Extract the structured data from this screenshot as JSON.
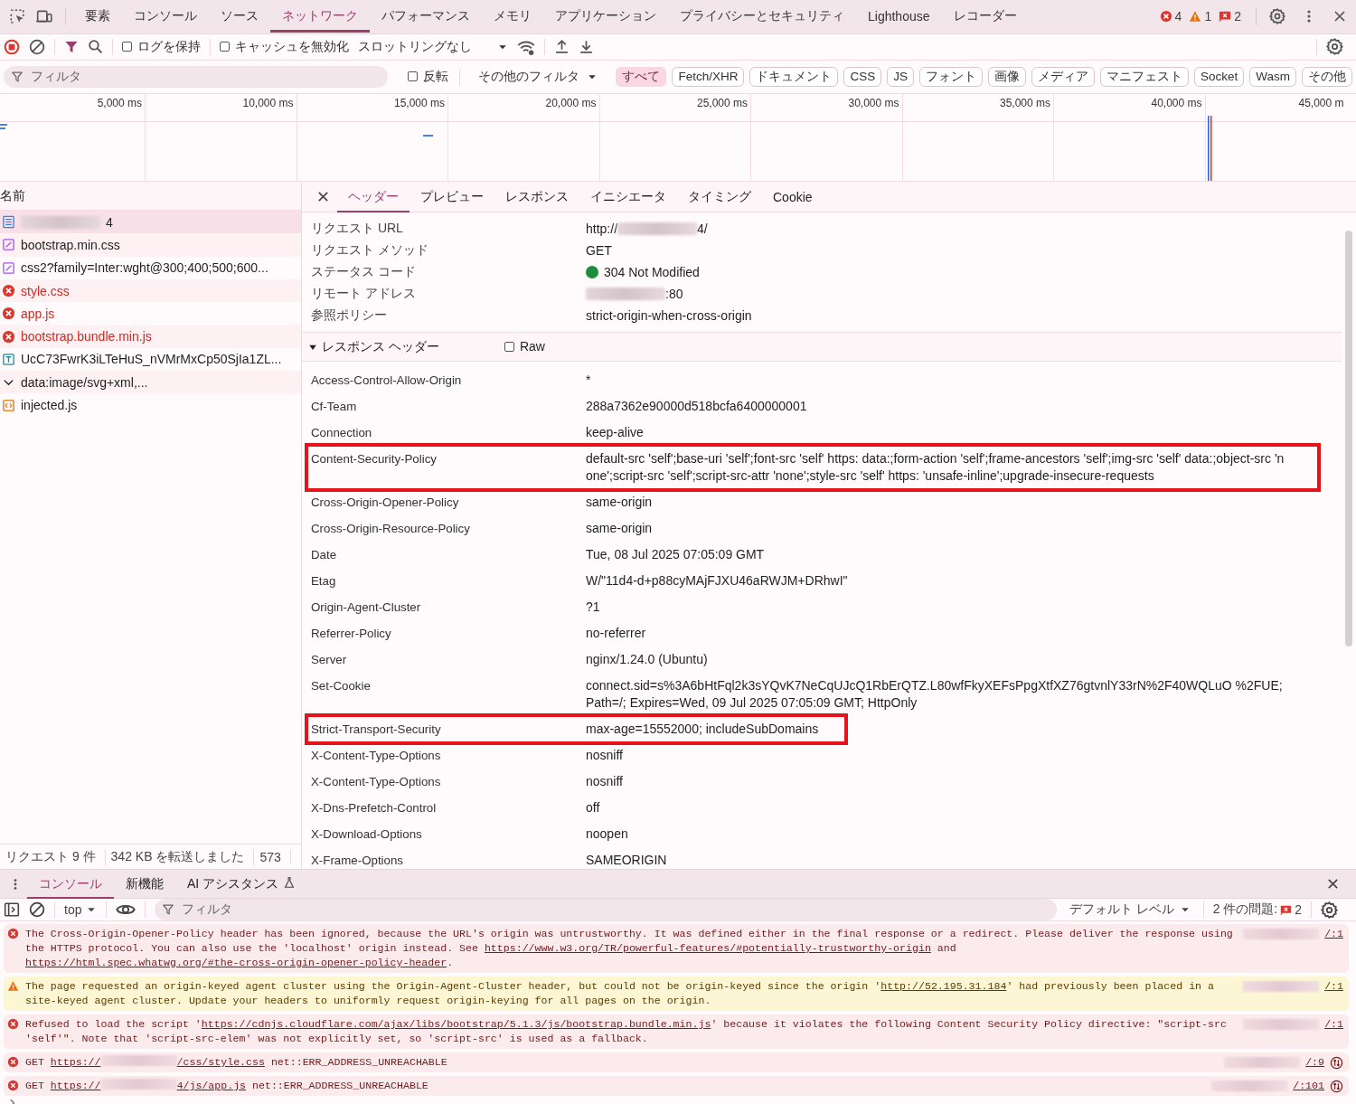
{
  "main_tabs": [
    {
      "label": "要素",
      "selected": false
    },
    {
      "label": "コンソール",
      "selected": false
    },
    {
      "label": "ソース",
      "selected": false
    },
    {
      "label": "ネットワーク",
      "selected": true
    },
    {
      "label": "パフォーマンス",
      "selected": false
    },
    {
      "label": "メモリ",
      "selected": false
    },
    {
      "label": "アプリケーション",
      "selected": false
    },
    {
      "label": "プライバシーとセキュリティ",
      "selected": false
    },
    {
      "label": "Lighthouse",
      "selected": false
    },
    {
      "label": "レコーダー",
      "selected": false
    }
  ],
  "issue_counts": {
    "errors": "4",
    "warnings": "1",
    "issues": "2"
  },
  "network_toolbar": {
    "recording": true,
    "preserve_log": {
      "label": "ログを保持",
      "checked": false
    },
    "disable_cache": {
      "label": "キャッシュを無効化",
      "checked": false
    },
    "throttling": "スロットリングなし"
  },
  "filter_bar": {
    "placeholder": "フィルタ",
    "invert": {
      "label": "反転",
      "checked": false
    },
    "more_filters": "その他のフィルタ",
    "types": [
      {
        "label": "すべて",
        "selected": true
      },
      {
        "label": "Fetch/XHR",
        "selected": false
      },
      {
        "label": "ドキュメント",
        "selected": false
      },
      {
        "label": "CSS",
        "selected": false
      },
      {
        "label": "JS",
        "selected": false
      },
      {
        "label": "フォント",
        "selected": false
      },
      {
        "label": "画像",
        "selected": false
      },
      {
        "label": "メディア",
        "selected": false
      },
      {
        "label": "マニフェスト",
        "selected": false
      },
      {
        "label": "Socket",
        "selected": false
      },
      {
        "label": "Wasm",
        "selected": false
      },
      {
        "label": "その他",
        "selected": false
      }
    ]
  },
  "timeline": {
    "ticks": [
      "5,000 ms",
      "10,000 ms",
      "15,000 ms",
      "20,000 ms",
      "25,000 ms",
      "30,000 ms",
      "35,000 ms",
      "40,000 ms",
      "45,000 m"
    ]
  },
  "requests": {
    "column": "名前",
    "items": [
      {
        "name": "4",
        "kind": "document",
        "redacted": true,
        "failed": false,
        "selected": true
      },
      {
        "name": "bootstrap.min.css",
        "kind": "stylesheet",
        "redacted": false,
        "failed": false,
        "selected": false
      },
      {
        "name": "css2?family=Inter:wght@300;400;500;600...",
        "kind": "stylesheet",
        "redacted": false,
        "failed": false,
        "selected": false
      },
      {
        "name": "style.css",
        "redacted": false,
        "failed": true,
        "selected": false
      },
      {
        "name": "app.js",
        "redacted": false,
        "failed": true,
        "selected": false
      },
      {
        "name": "bootstrap.bundle.min.js",
        "redacted": false,
        "failed": true,
        "selected": false
      },
      {
        "name": "UcC73FwrK3iLTeHuS_nVMrMxCp50SjIa1ZL...",
        "kind": "font",
        "redacted": false,
        "failed": false,
        "selected": false
      },
      {
        "name": "data:image/svg+xml,...",
        "kind": "group",
        "redacted": false,
        "failed": false,
        "selected": false
      },
      {
        "name": "injected.js",
        "kind": "script",
        "redacted": false,
        "failed": false,
        "selected": false
      }
    ]
  },
  "status_bar": [
    "リクエスト 9 件",
    "342 KB を転送しました",
    "573"
  ],
  "detail_tabs": [
    {
      "label": "ヘッダー",
      "selected": true
    },
    {
      "label": "プレビュー",
      "selected": false
    },
    {
      "label": "レスポンス",
      "selected": false
    },
    {
      "label": "イニシエータ",
      "selected": false
    },
    {
      "label": "タイミング",
      "selected": false
    },
    {
      "label": "Cookie",
      "selected": false
    }
  ],
  "general": [
    {
      "name": "リクエスト URL",
      "value": "http://",
      "redacted": true,
      "suffix": "4/"
    },
    {
      "name": "リクエスト メソッド",
      "value": "GET",
      "redacted": false
    },
    {
      "name": "ステータス コード",
      "value": "304 Not Modified",
      "redacted": false,
      "kind": "status"
    },
    {
      "name": "リモート アドレス",
      "redacted": true,
      "suffix": ":80"
    },
    {
      "name": "参照ポリシー",
      "value": "strict-origin-when-cross-origin",
      "redacted": false
    }
  ],
  "response_headers": {
    "title": "レスポンス ヘッダー",
    "expanded": true,
    "raw": {
      "label": "Raw",
      "checked": false
    },
    "rows": [
      {
        "name": "Access-Control-Allow-Origin",
        "value": "*",
        "highlighted": false
      },
      {
        "name": "Cf-Team",
        "value": "288a7362e90000d518bcfa6400000001",
        "highlighted": false
      },
      {
        "name": "Connection",
        "value": "keep-alive",
        "highlighted": false
      },
      {
        "name": "Content-Security-Policy",
        "value": "default-src 'self';base-uri 'self';font-src 'self' https: data:;form-action 'self';frame-ancestors 'self';img-src 'self' data:;object-src 'none';script-src 'self';script-src-attr 'none';style-src 'self' https: 'unsafe-inline';upgrade-insecure-requests",
        "highlighted": true
      },
      {
        "name": "Cross-Origin-Opener-Policy",
        "value": "same-origin",
        "highlighted": false
      },
      {
        "name": "Cross-Origin-Resource-Policy",
        "value": "same-origin",
        "highlighted": false
      },
      {
        "name": "Date",
        "value": "Tue, 08 Jul 2025 07:05:09 GMT",
        "highlighted": false
      },
      {
        "name": "Etag",
        "value": "W/\"11d4-d+p88cyMAjFJXU46aRWJM+DRhwI\"",
        "highlighted": false
      },
      {
        "name": "Origin-Agent-Cluster",
        "value": "?1",
        "highlighted": false
      },
      {
        "name": "Referrer-Policy",
        "value": "no-referrer",
        "highlighted": false
      },
      {
        "name": "Server",
        "value": "nginx/1.24.0 (Ubuntu)",
        "highlighted": false
      },
      {
        "name": "Set-Cookie",
        "value": "connect.sid=s%3A6bHtFql2k3sYQvK7NeCqUJcQ1RbErQTZ.L80wfFkyXEFsPpgXtfXZ76gtvnlY33rN%2F40WQLuO %2FUE; Path=/; Expires=Wed, 09 Jul 2025 07:05:09 GMT; HttpOnly",
        "highlighted": false
      },
      {
        "name": "Strict-Transport-Security",
        "value": "max-age=15552000; includeSubDomains",
        "highlighted": true
      },
      {
        "name": "X-Content-Type-Options",
        "value": "nosniff",
        "highlighted": false
      },
      {
        "name": "X-Content-Type-Options",
        "value": "nosniff",
        "highlighted": false
      },
      {
        "name": "X-Dns-Prefetch-Control",
        "value": "off",
        "highlighted": false
      },
      {
        "name": "X-Download-Options",
        "value": "noopen",
        "highlighted": false
      },
      {
        "name": "X-Frame-Options",
        "value": "SAMEORIGIN",
        "highlighted": false
      }
    ]
  },
  "drawer_tabs": [
    {
      "label": "コンソール",
      "selected": true
    },
    {
      "label": "新機能",
      "selected": false
    },
    {
      "label": "AI アシスタンス",
      "selected": false
    }
  ],
  "console_toolbar": {
    "context": "top",
    "placeholder": "フィルタ",
    "level": "デフォルト レベル",
    "issues": "2 件の問題:",
    "issue_count": "2"
  },
  "messages": [
    {
      "kind": "error",
      "request_icon": false,
      "source": "/:1",
      "parts": [
        {
          "kind": "text",
          "text": "The Cross-Origin-Opener-Policy header has been ignored, because the URL's origin was untrustworthy. It was defined either in the final response or a redirect. Please deliver the response using the HTTPS protocol. You can also use the 'localhost' origin instead. See "
        },
        {
          "kind": "link",
          "text": "https://www.w3.org/TR/powerful-features/#potentially-trustworthy-origin"
        },
        {
          "kind": "text",
          "text": " and "
        },
        {
          "kind": "link",
          "text": "https://html.spec.whatwg.org/#the-cross-origin-opener-policy-header"
        },
        {
          "kind": "text",
          "text": "."
        }
      ]
    },
    {
      "kind": "warning",
      "request_icon": false,
      "source": "/:1",
      "parts": [
        {
          "kind": "text",
          "text": "The page requested an origin-keyed agent cluster using the Origin-Agent-Cluster header, but could not be origin-keyed since the origin '"
        },
        {
          "kind": "link",
          "text": "http://52.195.31.184"
        },
        {
          "kind": "text",
          "text": "' had previously been placed in a site-keyed agent cluster. Update your headers to uniformly request origin-keying for all pages on the origin."
        }
      ]
    },
    {
      "kind": "error",
      "request_icon": false,
      "source": "/:1",
      "parts": [
        {
          "kind": "text",
          "text": "Refused to load the script '"
        },
        {
          "kind": "link",
          "text": "https://cdnjs.cloudflare.com/ajax/libs/bootstrap/5.1.3/js/bootstrap.bundle.min.js"
        },
        {
          "kind": "text",
          "text": "' because it violates the following Content Security Policy directive: \"script-src 'self'\". Note that 'script-src-elem' was not explicitly set, so 'script-src' is used as a fallback."
        }
      ]
    },
    {
      "kind": "error",
      "request_icon": true,
      "source": "/:9",
      "parts": [
        {
          "kind": "text",
          "text": "GET "
        },
        {
          "kind": "link",
          "text": "https://"
        },
        {
          "kind": "redacted"
        },
        {
          "kind": "link",
          "text": "/css/style.css"
        },
        {
          "kind": "text",
          "text": " net::ERR_ADDRESS_UNREACHABLE"
        }
      ]
    },
    {
      "kind": "error",
      "request_icon": true,
      "source": "/:101",
      "parts": [
        {
          "kind": "text",
          "text": "GET "
        },
        {
          "kind": "link",
          "text": "https://"
        },
        {
          "kind": "redacted"
        },
        {
          "kind": "link",
          "text": "4/js/app.js"
        },
        {
          "kind": "text",
          "text": " net::ERR_ADDRESS_UNREACHABLE"
        }
      ]
    }
  ]
}
